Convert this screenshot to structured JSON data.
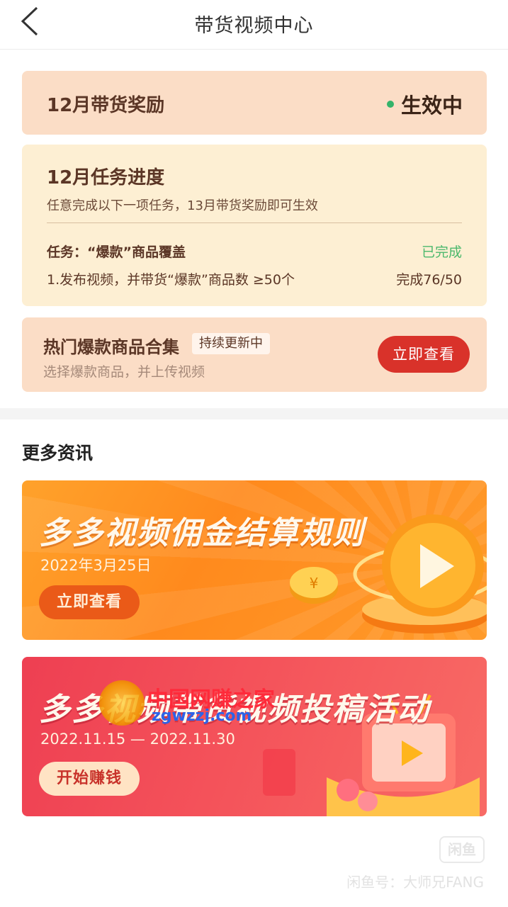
{
  "header": {
    "title": "带货视频中心"
  },
  "reward_card": {
    "title": "12月带货奖励",
    "status": "生效中"
  },
  "task_card": {
    "title": "12月任务进度",
    "subtitle": "任意完成以下一项任务，13月带货奖励即可生效",
    "task_name": "任务：“爆款”商品覆盖",
    "task_status": "已完成",
    "task_desc": "1.发布视频，并带货“爆款”商品数 ≥50个",
    "task_progress": "完成76/50"
  },
  "hot_card": {
    "title": "热门爆款商品合集",
    "tag": "持续更新中",
    "subtitle": "选择爆款商品，并上传视频",
    "button_label": "立即查看"
  },
  "more_section": {
    "title": "更多资讯"
  },
  "banners": [
    {
      "title": "多多视频佣金结算规则",
      "date": "2022年3月25日",
      "button_label": "立即查看"
    },
    {
      "title": "多多视频带货视频投稿活动",
      "date": "2022.11.15 — 2022.11.30",
      "button_label": "开始赚钱"
    }
  ],
  "watermark": {
    "site_name": "中国网赚之家",
    "site_domain": "zgwzzj.com",
    "badge": "闲鱼",
    "footer": "闲鱼号：大师兄FANG"
  },
  "colors": {
    "accent_red": "#d9322a",
    "status_green": "#34b36a",
    "card_peach": "#fbddc6",
    "card_cream": "#fdefd3"
  }
}
